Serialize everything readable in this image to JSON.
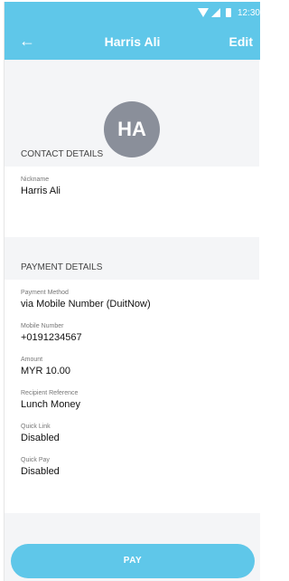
{
  "status": {
    "time": "12:30"
  },
  "header": {
    "title": "Harris Ali",
    "edit_label": "Edit"
  },
  "contact": {
    "initials": "HA"
  },
  "sections": {
    "contact_details": "CONTACT DETAILS",
    "payment_details": "PAYMENT DETAILS"
  },
  "fields": {
    "nickname": {
      "label": "Nickname",
      "value": "Harris Ali"
    },
    "payment_method": {
      "label": "Payment Method",
      "value": "via Mobile Number (DuitNow)"
    },
    "mobile_number": {
      "label": "Mobile Number",
      "value": "+0191234567"
    },
    "amount": {
      "label": "Amount",
      "value": "MYR 10.00"
    },
    "recipient_reference": {
      "label": "Recipient Reference",
      "value": "Lunch Money"
    },
    "quick_link": {
      "label": "Quick Link",
      "value": "Disabled"
    },
    "quick_pay": {
      "label": "Quick Pay",
      "value": "Disabled"
    }
  },
  "actions": {
    "pay_label": "PAY"
  },
  "icons": {
    "back": "arrow-left-icon",
    "wifi": "wifi-icon",
    "signal": "signal-icon",
    "battery": "battery-icon"
  },
  "colors": {
    "accent": "#5fc7e9",
    "avatar": "#8a8f9a",
    "background": "#f4f5f7"
  }
}
